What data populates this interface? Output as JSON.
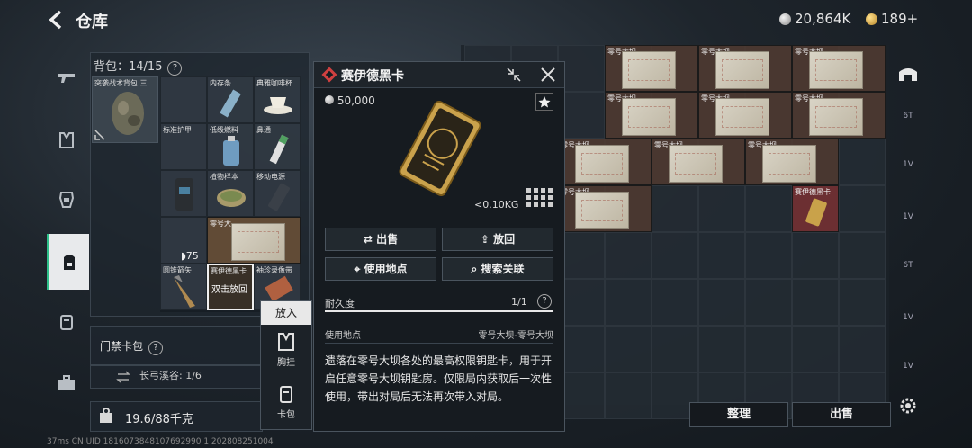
{
  "header": {
    "title": "仓库",
    "currency_silver": "20,864K",
    "currency_gold": "189+"
  },
  "backpack": {
    "label": "背包：14/15",
    "bag_name": "突袭战术背包 三",
    "slots": {
      "armor": "标准护甲",
      "memory": "内存条",
      "cup": "典雅咖啡杯",
      "fuel": "低级燃料",
      "nasal": "鼻通",
      "plant": "植物样本",
      "power": "移动电源",
      "tape": "零号大",
      "arrow": "圆锥箭矢",
      "keycard": "赛伊德黑卡",
      "keycard_hint": "双击放回",
      "collect": "袖珍录像带",
      "armor_value": "75"
    }
  },
  "keycard_pack": {
    "label": "门禁卡包",
    "sub": "长弓溪谷: 1/6"
  },
  "capacity": {
    "value": "19.6/88千克"
  },
  "putin_menu": {
    "title": "放入",
    "opt1": "胸挂",
    "opt2": "卡包"
  },
  "storage": {
    "map_label": "零号大坝",
    "keycard_label": "赛伊德黑卡"
  },
  "bottom_buttons": {
    "sort": "整理",
    "sell": "出售"
  },
  "detail": {
    "title": "赛伊德黑卡",
    "price": "50,000",
    "weight": "<0.10KG",
    "sell": "出售",
    "return": "放回",
    "use_place": "使用地点",
    "search": "搜索关联",
    "durability_label": "耐久度",
    "durability_value": "1/1",
    "durability_fraction": 1.0,
    "use_label": "使用地点",
    "use_value": "零号大坝-零号大坝",
    "description": "遗落在零号大坝各处的最高权限钥匙卡，用于开启任意零号大坝钥匙房。仅限局内获取后一次性使用，带出对局后无法再次带入对局。"
  },
  "status": {
    "text": "37ms    CN UID 1816073848107692990 1   202808251004"
  },
  "colors": {
    "accent": "#2ec08a",
    "keycard_red": "#8c3232",
    "gold": "#c9a24a"
  }
}
